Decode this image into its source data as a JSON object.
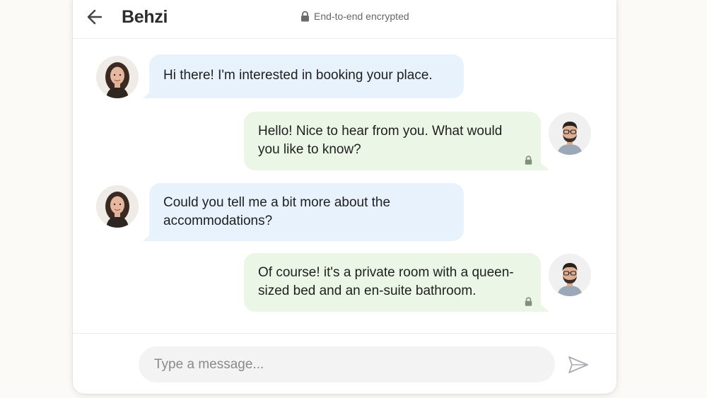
{
  "header": {
    "back_icon": "arrow-left-icon",
    "title": "Behzi",
    "encryption_icon": "lock-icon",
    "encryption_text": "End-to-end encrypted"
  },
  "messages": [
    {
      "direction": "incoming",
      "sender_avatar": "woman-avatar",
      "text_lines": [
        "Hi there! I'm interested in booking your place."
      ]
    },
    {
      "direction": "outgoing",
      "sender_avatar": "man-avatar",
      "text_lines": [
        "Hello! Nice to hear from you. What would",
        "you like to know?"
      ],
      "status_icon": "lock-icon"
    },
    {
      "direction": "incoming",
      "sender_avatar": "woman-avatar",
      "text_lines": [
        "Could you tell me a bit more about the",
        "accommodations?"
      ]
    },
    {
      "direction": "outgoing",
      "sender_avatar": "man-avatar",
      "text_lines": [
        "Of course! it's a private room with a queen-",
        "sized bed and an en-suite bathroom."
      ],
      "status_icon": "lock-icon"
    }
  ],
  "composer": {
    "placeholder": "Type a message...",
    "value": "",
    "send_icon": "send-icon"
  },
  "colors": {
    "incoming_bubble": "#e7f2fd",
    "outgoing_bubble": "#ebf6e6",
    "background": "#fbfaf6"
  }
}
